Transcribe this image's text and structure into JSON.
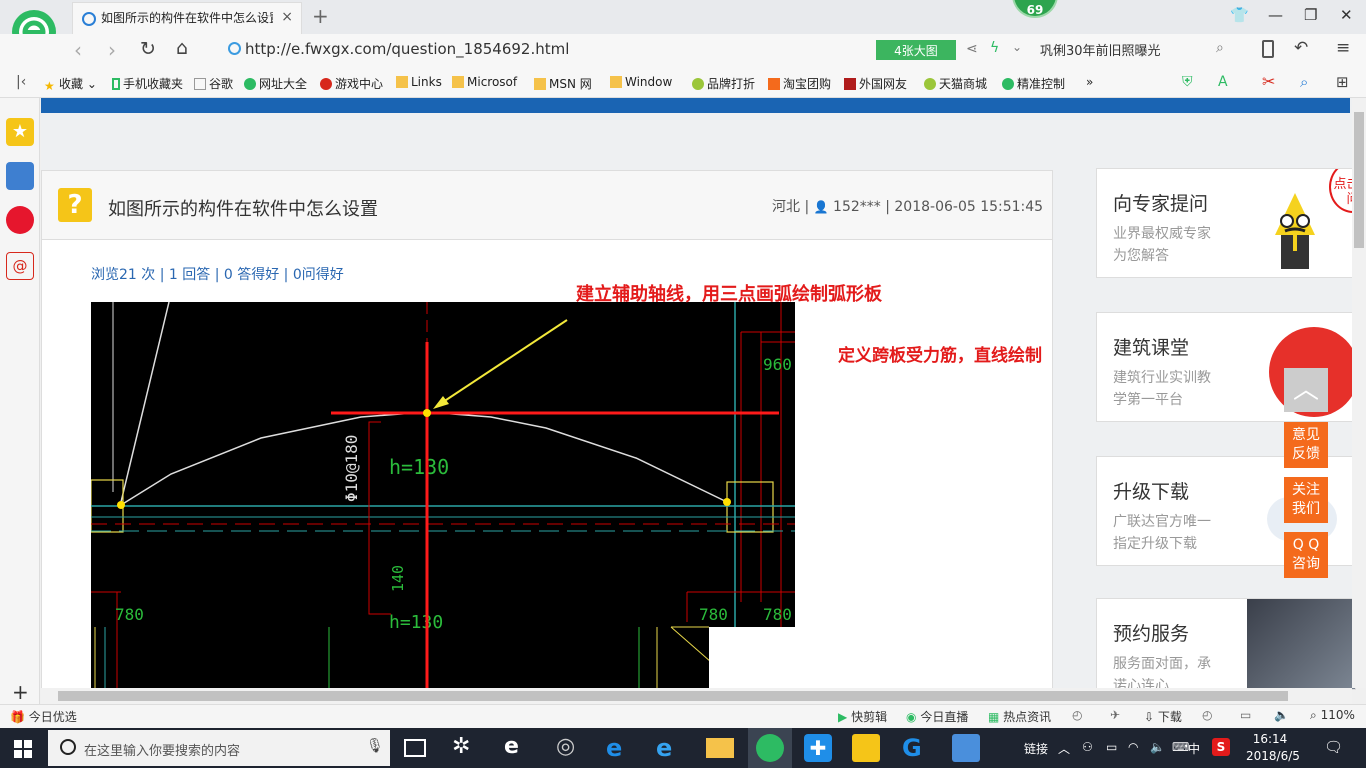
{
  "browser": {
    "tab_title": "如图所示的构件在软件中怎么设置",
    "tab_close": "×",
    "new_tab": "+",
    "badge_count": "69",
    "url": "http://e.fwxgx.com/question_1854692.html",
    "big_image_label": "4张大图",
    "search_text": "巩俐30年前旧照曝光",
    "colors": {
      "accent": "#1a64b3",
      "badge": "#2da44e",
      "orange": "#f46a1c",
      "annotation": "#e31b1b"
    }
  },
  "bookmarks": [
    "收藏",
    "手机收藏夹",
    "谷歌",
    "网址大全",
    "游戏中心",
    "Links",
    "Microsof",
    "MSN 网",
    "Window",
    "品牌打折",
    "淘宝团购",
    "外国网友",
    "天猫商城",
    "精准控制"
  ],
  "bookmarks_more": "»",
  "question": {
    "title": "如图所示的构件在软件中怎么设置",
    "region": "河北",
    "user": "152***",
    "datetime": "2018-06-05 15:51:45",
    "stats": "浏览21 次 | 1 回答 | 0 答得好 | 0问得好"
  },
  "annotations": {
    "line1": "建立辅助轴线，用三点画弧绘制弧形板",
    "line2": "定义跨板受力筋，直线绘制"
  },
  "cad_labels": {
    "rebar": "Φ10@180",
    "thickness": "h=130",
    "dim_960": "960",
    "dim_140": "140",
    "dim_780_left": "780",
    "dim_780_mid": "780",
    "dim_780_right": "780",
    "h_bottom": "h=130"
  },
  "sidebar_cards": [
    {
      "title": "向专家提问",
      "line1": "业界最权威专家",
      "line2": "为您解答",
      "bubble": "点击提问"
    },
    {
      "title": "建筑课堂",
      "line1": "建筑行业实训教",
      "line2": "学第一平台"
    },
    {
      "title": "升级下载",
      "line1": "广联达官方唯一",
      "line2": "指定升级下载"
    },
    {
      "title": "预约服务",
      "line1": "服务面对面，承",
      "line2": "诺心连心"
    }
  ],
  "float_buttons": [
    "意见\n反馈",
    "关注\n我们",
    "Q Q\n咨询"
  ],
  "float_top": "︿",
  "statusbar": {
    "left": "今日优选",
    "items": [
      "快剪辑",
      "今日直播",
      "热点资讯",
      "下载"
    ],
    "zoom": "110%"
  },
  "taskbar": {
    "search_placeholder": "在这里输入你要搜索的内容",
    "tray_label": "链接",
    "ime": "中",
    "time": "16:14",
    "date": "2018/6/5"
  }
}
